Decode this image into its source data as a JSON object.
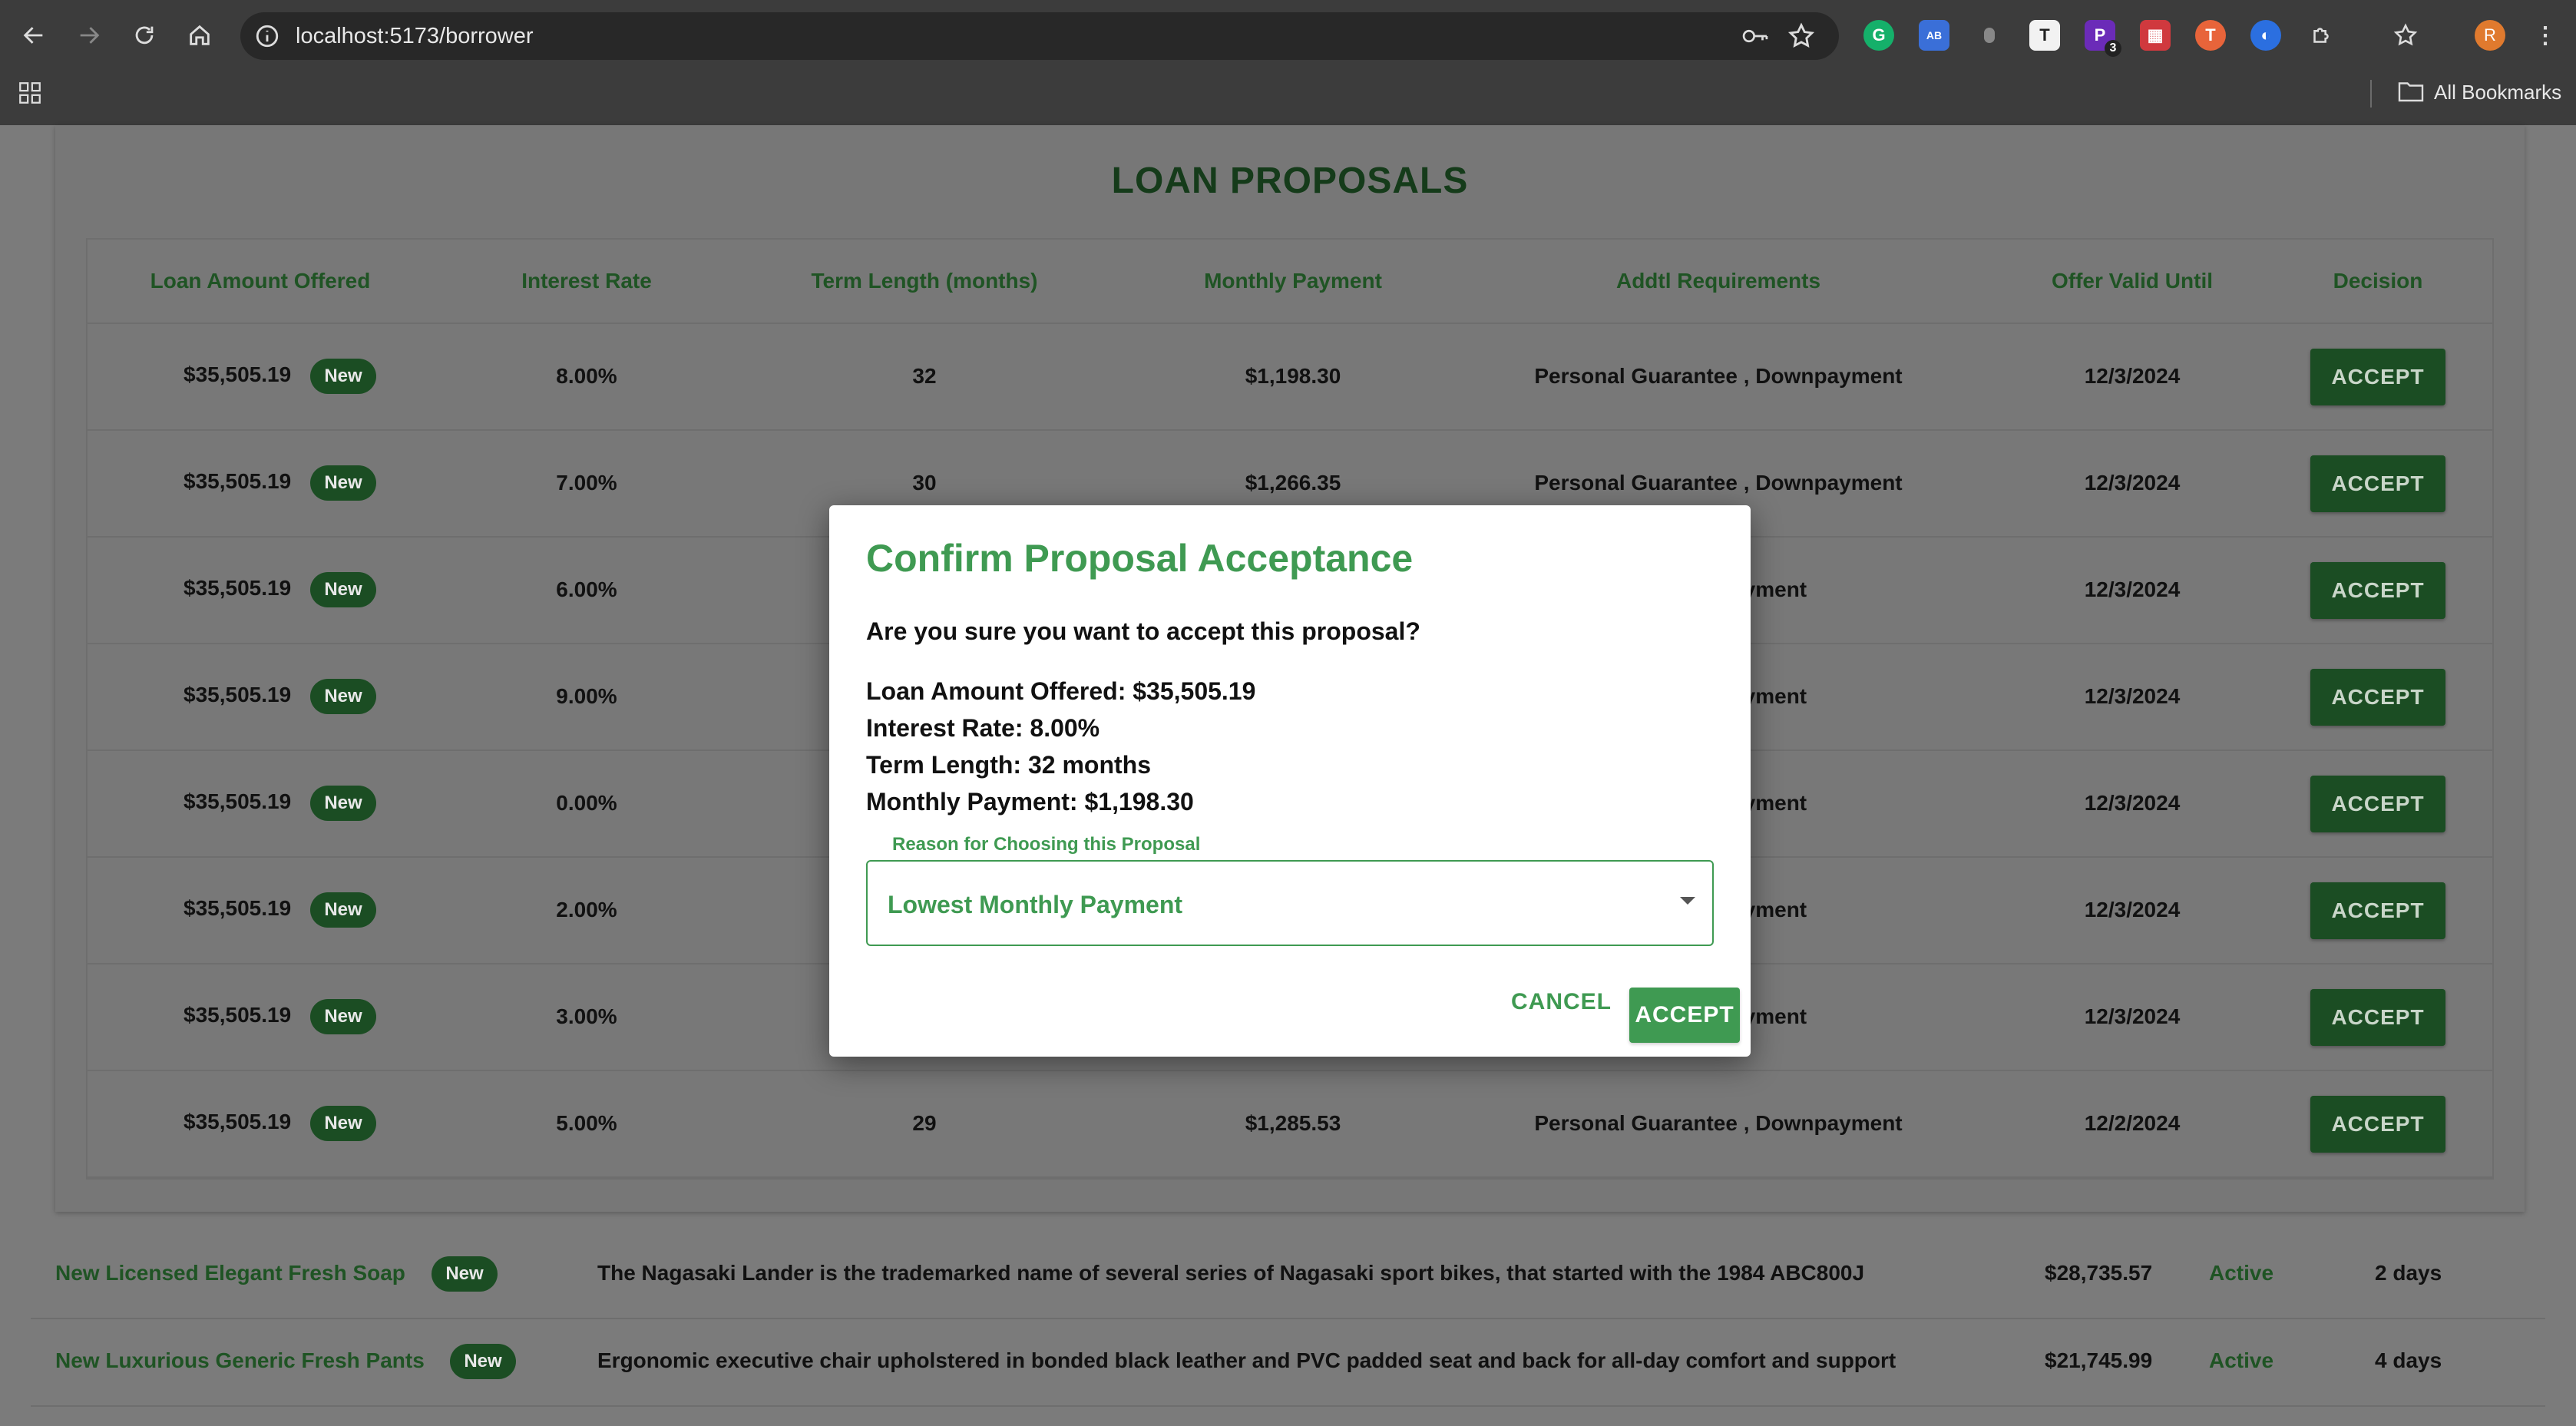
{
  "browser": {
    "url": "localhost:5173/borrower",
    "bookmarks_label": "All Bookmarks",
    "profile_initial": "R",
    "extension_badge": "3"
  },
  "proposals": {
    "title": "LOAN PROPOSALS",
    "columns": [
      "Loan Amount Offered",
      "Interest Rate",
      "Term Length (months)",
      "Monthly Payment",
      "Addtl Requirements",
      "Offer Valid Until",
      "Decision"
    ],
    "rows": [
      {
        "amount": "$35,505.19",
        "badge": "New",
        "rate": "8.00%",
        "term": "32",
        "payment": "$1,198.30",
        "requirements": "Personal Guarantee , Downpayment",
        "valid_until": "12/3/2024",
        "action": "ACCEPT"
      },
      {
        "amount": "$35,505.19",
        "badge": "New",
        "rate": "7.00%",
        "term": "30",
        "payment": "$1,266.35",
        "requirements": "Personal Guarantee , Downpayment",
        "valid_until": "12/3/2024",
        "action": "ACCEPT"
      },
      {
        "amount": "$35,505.19",
        "badge": "New",
        "rate": "6.00%",
        "term": "",
        "payment": "",
        "requirements": "e , Downpayment",
        "valid_until": "12/3/2024",
        "action": "ACCEPT"
      },
      {
        "amount": "$35,505.19",
        "badge": "New",
        "rate": "9.00%",
        "term": "",
        "payment": "",
        "requirements": "e , Downpayment",
        "valid_until": "12/3/2024",
        "action": "ACCEPT"
      },
      {
        "amount": "$35,505.19",
        "badge": "New",
        "rate": "0.00%",
        "term": "",
        "payment": "",
        "requirements": "e , Downpayment",
        "valid_until": "12/3/2024",
        "action": "ACCEPT"
      },
      {
        "amount": "$35,505.19",
        "badge": "New",
        "rate": "2.00%",
        "term": "",
        "payment": "",
        "requirements": "e , Downpayment",
        "valid_until": "12/3/2024",
        "action": "ACCEPT"
      },
      {
        "amount": "$35,505.19",
        "badge": "New",
        "rate": "3.00%",
        "term": "",
        "payment": "",
        "requirements": "e , Downpayment",
        "valid_until": "12/3/2024",
        "action": "ACCEPT"
      },
      {
        "amount": "$35,505.19",
        "badge": "New",
        "rate": "5.00%",
        "term": "29",
        "payment": "$1,285.53",
        "requirements": "Personal Guarantee , Downpayment",
        "valid_until": "12/2/2024",
        "action": "ACCEPT"
      }
    ]
  },
  "listings": [
    {
      "name": "New Licensed Elegant Fresh Soap",
      "badge": "New",
      "description": "The Nagasaki Lander is the trademarked name of several series of Nagasaki sport bikes, that started with the 1984 ABC800J",
      "price": "$28,735.57",
      "status": "Active",
      "age": "2 days"
    },
    {
      "name": "New Luxurious Generic Fresh Pants",
      "badge": "New",
      "description": "Ergonomic executive chair upholstered in bonded black leather and PVC padded seat and back for all-day comfort and support",
      "price": "$21,745.99",
      "status": "Active",
      "age": "4 days"
    }
  ],
  "modal": {
    "title": "Confirm Proposal Acceptance",
    "question": "Are you sure you want to accept this proposal?",
    "details": [
      "Loan Amount Offered: $35,505.19",
      "Interest Rate: 8.00%",
      "Term Length: 32 months",
      "Monthly Payment: $1,198.30"
    ],
    "select_label": "Reason for Choosing this Proposal",
    "select_value": "Lowest Monthly Payment",
    "cancel_label": "CANCEL",
    "accept_label": "ACCEPT"
  }
}
